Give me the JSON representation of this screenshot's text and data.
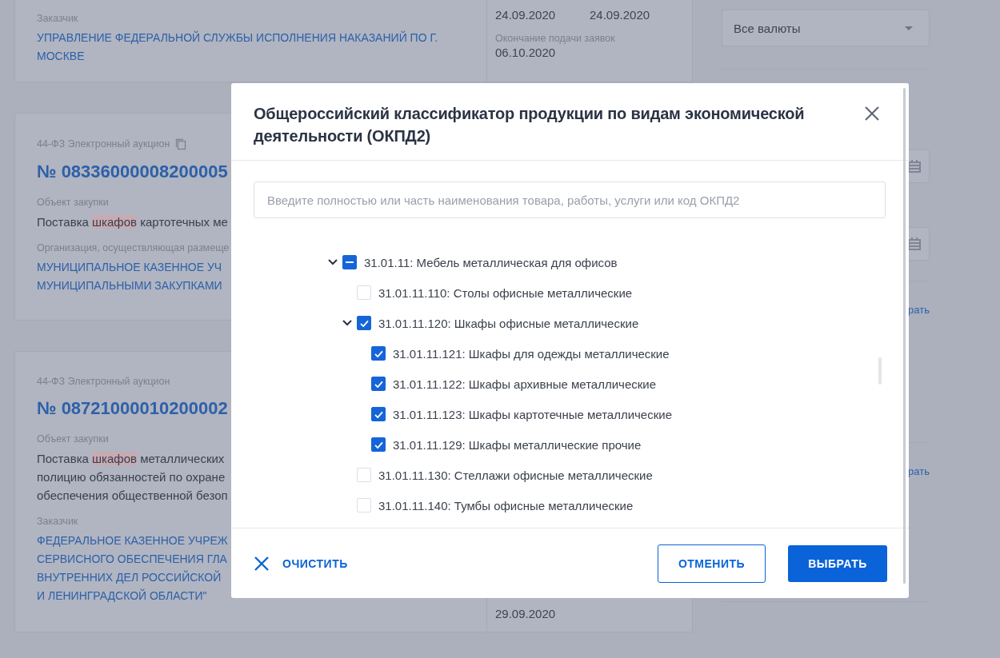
{
  "cards": [
    {
      "kind": "summary",
      "customer_label": "Заказчик",
      "customer": "УПРАВЛЕНИЕ ФЕДЕРАЛЬНОЙ СЛУЖБЫ ИСПОЛНЕНИЯ НАКАЗАНИЙ ПО Г. МОСКВЕ",
      "dates": [
        "24.09.2020",
        "24.09.2020"
      ],
      "deadline_label": "Окончание подачи заявок",
      "deadline": "06.10.2020"
    },
    {
      "kind": "tender",
      "type": "44-ФЗ Электронный аукцион",
      "copyable": true,
      "number": "№ 08336000008200005",
      "object_label": "Объект закупки",
      "object_lines": [
        [
          {
            "t": "Поставка "
          },
          {
            "t": "шкафов",
            "hl": true
          },
          {
            "t": " картотечных ме"
          }
        ]
      ],
      "org_label": "Организация, осуществляющая размеще",
      "org_lines": [
        "МУНИЦИПАЛЬНОЕ КАЗЕННОЕ УЧ",
        "МУНИЦИПАЛЬНЫМИ ЗАКУПКАМИ"
      ]
    },
    {
      "kind": "tender",
      "type": "44-ФЗ Электронный аукцион",
      "copyable": false,
      "number": "№ 08721000010200002",
      "object_label": "Объект закупки",
      "object_lines": [
        [
          {
            "t": "Поставка "
          },
          {
            "t": "шкафов",
            "hl": true
          },
          {
            "t": " металлических"
          }
        ],
        [
          {
            "t": "полицию обязанностей по охране"
          }
        ],
        [
          {
            "t": "обеспечения общественной безоп"
          }
        ]
      ],
      "org_label": "Заказчик",
      "org_lines": [
        "ФЕДЕРАЛЬНОЕ КАЗЕННОЕ УЧРЕЖ",
        "СЕРВИСНОГО ОБЕСПЕЧЕНИЯ ГЛА",
        "ВНУТРЕННИХ ДЕЛ РОССИЙСКОЙ",
        "И ЛЕНИНГРАДСКОЙ ОБЛАСТИ\""
      ],
      "date": "29.09.2020"
    }
  ],
  "sidebar": {
    "currency": "Все валюты",
    "links": [
      "рать",
      "рать"
    ]
  },
  "modal": {
    "title": "Общероссийский классификатор продукции по видам экономической деятельности (ОКПД2)",
    "search_placeholder": "Введите полностью или часть наименования товара, работы, услуги или код ОКПД2",
    "tree": [
      {
        "label": "31.01.11: Мебель металлическая для офисов",
        "checked": false,
        "indeterminate": true,
        "expanded": true,
        "children": [
          {
            "label": "31.01.11.110: Столы офисные металлические",
            "checked": false,
            "indeterminate": false
          },
          {
            "label": "31.01.11.120: Шкафы офисные металлические",
            "checked": true,
            "indeterminate": false,
            "expanded": true,
            "children": [
              {
                "label": "31.01.11.121: Шкафы для одежды металлические",
                "checked": true,
                "indeterminate": false
              },
              {
                "label": "31.01.11.122: Шкафы архивные металлические",
                "checked": true,
                "indeterminate": false
              },
              {
                "label": "31.01.11.123: Шкафы картотечные металлические",
                "checked": true,
                "indeterminate": false
              },
              {
                "label": "31.01.11.129: Шкафы металлические прочие",
                "checked": true,
                "indeterminate": false
              }
            ]
          },
          {
            "label": "31.01.11.130: Стеллажи офисные металлические",
            "checked": false,
            "indeterminate": false
          },
          {
            "label": "31.01.11.140: Тумбы офисные металлические",
            "checked": false,
            "indeterminate": false
          }
        ]
      }
    ],
    "clear": "ОЧИСТИТЬ",
    "cancel": "ОТМЕНИТЬ",
    "select": "ВЫБРАТЬ"
  }
}
